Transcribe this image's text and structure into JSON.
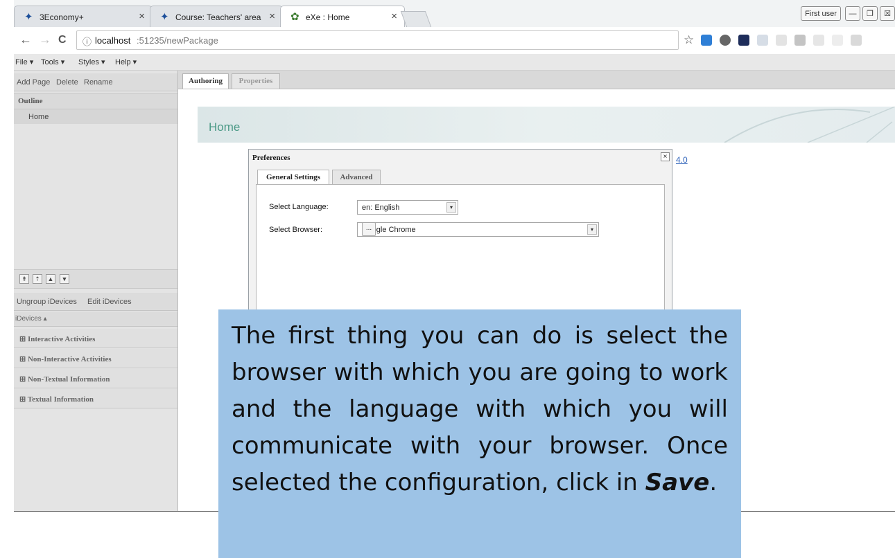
{
  "browser": {
    "tabs": [
      {
        "title": "3Economy+",
        "icon": "economy-favicon",
        "active": false
      },
      {
        "title": "Course: Teachers' area",
        "icon": "economy-favicon",
        "active": false
      },
      {
        "title": "eXe : Home",
        "icon": "exe-favicon",
        "active": true
      }
    ],
    "close_glyph": "×",
    "user_label": "First user",
    "window_controls": {
      "minimize": "—",
      "restore": "❐",
      "close": "☒"
    },
    "nav": {
      "back": "←",
      "forward": "→",
      "reload": "C",
      "info": "ⓘ"
    },
    "url_host": "localhost",
    "url_rest": ":51235/newPackage",
    "star": "☆"
  },
  "exe_menu": [
    "File ▾",
    "Tools ▾",
    "Styles ▾",
    "Help ▾"
  ],
  "left_panel": {
    "page_actions": [
      "Add Page",
      "Delete",
      "Rename"
    ],
    "outline_header": "Outline",
    "outline_items": [
      "Home"
    ],
    "move_buttons": [
      "⇞",
      "⇡",
      "▲",
      "▼"
    ],
    "idevice_actions": [
      "Ungroup iDevices",
      "Edit iDevices"
    ],
    "idevices_header": "iDevices ▴",
    "categories": [
      "⊞ Interactive Activities",
      "⊞ Non-Interactive Activities",
      "⊞ Non-Textual Information",
      "⊞ Textual Information"
    ]
  },
  "main": {
    "tabs": [
      "Authoring",
      "Properties"
    ],
    "page_title": "Home",
    "version_link": "4.0"
  },
  "dialog": {
    "title": "Preferences",
    "close_glyph": "×",
    "tabs": [
      "General Settings",
      "Advanced"
    ],
    "language_label": "Select Language:",
    "language_value": "en: English",
    "browser_label": "Select Browser:",
    "browser_value": "Google Chrome",
    "browse_button": "...",
    "dropdown_glyph": "▾"
  },
  "caption": {
    "text_before": "The first thing you can do is select the browser with which you are going to work and the language with which you will communicate with your browser. Once selected the configuration, click in ",
    "emphasis": "Save",
    "text_after": "."
  }
}
